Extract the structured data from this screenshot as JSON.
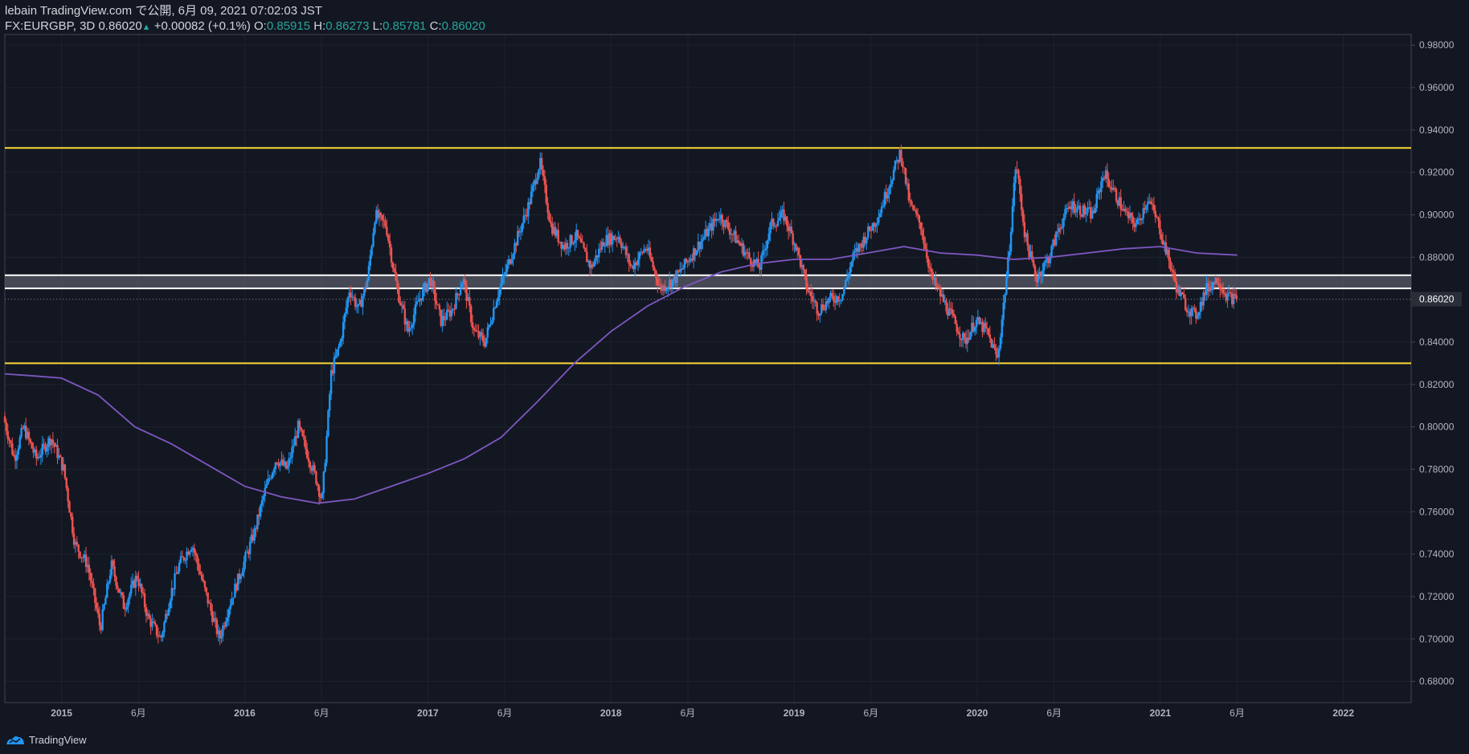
{
  "header": {
    "publish_line": "lebain TradingView.com で公開, 6月 09, 2021 07:02:03 JST",
    "symbol": "FX:EURGBP, 3D",
    "last": "0.86020",
    "change": "+0.00082 (+0.1%)",
    "o_label": "O:",
    "o_value": "0.85915",
    "h_label": "H:",
    "h_value": "0.86273",
    "l_label": "L:",
    "l_value": "0.85781",
    "c_label": "C:",
    "c_value": "0.86020"
  },
  "footer": {
    "brand": "TradingView",
    "logo_icon": "tradingview-logo-icon"
  },
  "colors": {
    "background": "#131722",
    "up": "#2196f3",
    "down": "#ef5350",
    "ma": "#7e57c2",
    "support_resistance": "#fdd835",
    "zone": "#ffffff",
    "grid": "#1e222d",
    "axis_text": "#b2b5be"
  },
  "chart_data": {
    "type": "candlestick",
    "symbol": "FX:EURGBP",
    "interval": "3D",
    "ylim": [
      0.67,
      0.985
    ],
    "y_ticks": [
      "0.98000",
      "0.96000",
      "0.94000",
      "0.92000",
      "0.90000",
      "0.88000",
      "0.86000",
      "0.84000",
      "0.82000",
      "0.80000",
      "0.78000",
      "0.76000",
      "0.74000",
      "0.72000",
      "0.70000",
      "0.68000"
    ],
    "x_ticks": [
      {
        "t": 2015.0,
        "label": "2015"
      },
      {
        "t": 2015.42,
        "label": "6月"
      },
      {
        "t": 2016.0,
        "label": "2016"
      },
      {
        "t": 2016.42,
        "label": "6月"
      },
      {
        "t": 2017.0,
        "label": "2017"
      },
      {
        "t": 2017.42,
        "label": "6月"
      },
      {
        "t": 2018.0,
        "label": "2018"
      },
      {
        "t": 2018.42,
        "label": "6月"
      },
      {
        "t": 2019.0,
        "label": "2019"
      },
      {
        "t": 2019.42,
        "label": "6月"
      },
      {
        "t": 2020.0,
        "label": "2020"
      },
      {
        "t": 2020.42,
        "label": "6月"
      },
      {
        "t": 2021.0,
        "label": "2021"
      },
      {
        "t": 2021.42,
        "label": "6月"
      },
      {
        "t": 2022.0,
        "label": "2022"
      }
    ],
    "xlim": [
      2014.69,
      2022.37
    ],
    "last_price": 0.8602,
    "last_price_label": "0.86020",
    "horizontal_lines": [
      {
        "name": "resistance",
        "price": 0.9315,
        "color": "#fdd835"
      },
      {
        "name": "support",
        "price": 0.83,
        "color": "#fdd835"
      }
    ],
    "zone": {
      "top": 0.8715,
      "bottom": 0.8653,
      "color": "#ffffff"
    },
    "price_path": [
      [
        2014.69,
        0.805
      ],
      [
        2014.75,
        0.785
      ],
      [
        2014.8,
        0.8
      ],
      [
        2014.87,
        0.785
      ],
      [
        2014.95,
        0.795
      ],
      [
        2015.02,
        0.78
      ],
      [
        2015.08,
        0.745
      ],
      [
        2015.15,
        0.735
      ],
      [
        2015.22,
        0.705
      ],
      [
        2015.28,
        0.735
      ],
      [
        2015.35,
        0.715
      ],
      [
        2015.42,
        0.73
      ],
      [
        2015.48,
        0.71
      ],
      [
        2015.55,
        0.7
      ],
      [
        2015.6,
        0.72
      ],
      [
        2015.65,
        0.735
      ],
      [
        2015.72,
        0.745
      ],
      [
        2015.8,
        0.72
      ],
      [
        2015.87,
        0.7
      ],
      [
        2015.92,
        0.715
      ],
      [
        2016.0,
        0.735
      ],
      [
        2016.06,
        0.75
      ],
      [
        2016.12,
        0.77
      ],
      [
        2016.18,
        0.785
      ],
      [
        2016.24,
        0.78
      ],
      [
        2016.3,
        0.8
      ],
      [
        2016.36,
        0.785
      ],
      [
        2016.4,
        0.775
      ],
      [
        2016.43,
        0.765
      ],
      [
        2016.46,
        0.8
      ],
      [
        2016.48,
        0.825
      ],
      [
        2016.53,
        0.84
      ],
      [
        2016.58,
        0.865
      ],
      [
        2016.63,
        0.855
      ],
      [
        2016.68,
        0.87
      ],
      [
        2016.72,
        0.9
      ],
      [
        2016.78,
        0.895
      ],
      [
        2016.84,
        0.865
      ],
      [
        2016.9,
        0.845
      ],
      [
        2016.96,
        0.86
      ],
      [
        2017.02,
        0.87
      ],
      [
        2017.08,
        0.85
      ],
      [
        2017.14,
        0.855
      ],
      [
        2017.2,
        0.87
      ],
      [
        2017.26,
        0.845
      ],
      [
        2017.32,
        0.84
      ],
      [
        2017.38,
        0.86
      ],
      [
        2017.44,
        0.875
      ],
      [
        2017.5,
        0.89
      ],
      [
        2017.56,
        0.905
      ],
      [
        2017.62,
        0.925
      ],
      [
        2017.68,
        0.895
      ],
      [
        2017.75,
        0.885
      ],
      [
        2017.82,
        0.89
      ],
      [
        2017.9,
        0.875
      ],
      [
        2017.97,
        0.888
      ],
      [
        2018.05,
        0.89
      ],
      [
        2018.12,
        0.875
      ],
      [
        2018.2,
        0.885
      ],
      [
        2018.28,
        0.865
      ],
      [
        2018.36,
        0.87
      ],
      [
        2018.44,
        0.88
      ],
      [
        2018.52,
        0.89
      ],
      [
        2018.6,
        0.9
      ],
      [
        2018.68,
        0.89
      ],
      [
        2018.76,
        0.88
      ],
      [
        2018.82,
        0.875
      ],
      [
        2018.88,
        0.895
      ],
      [
        2018.95,
        0.9
      ],
      [
        2019.02,
        0.885
      ],
      [
        2019.08,
        0.865
      ],
      [
        2019.14,
        0.855
      ],
      [
        2019.2,
        0.86
      ],
      [
        2019.27,
        0.862
      ],
      [
        2019.33,
        0.88
      ],
      [
        2019.4,
        0.89
      ],
      [
        2019.47,
        0.9
      ],
      [
        2019.53,
        0.915
      ],
      [
        2019.59,
        0.93
      ],
      [
        2019.64,
        0.905
      ],
      [
        2019.7,
        0.895
      ],
      [
        2019.76,
        0.87
      ],
      [
        2019.82,
        0.86
      ],
      [
        2019.88,
        0.85
      ],
      [
        2019.94,
        0.84
      ],
      [
        2020.0,
        0.85
      ],
      [
        2020.06,
        0.845
      ],
      [
        2020.12,
        0.832
      ],
      [
        2020.18,
        0.88
      ],
      [
        2020.22,
        0.925
      ],
      [
        2020.27,
        0.89
      ],
      [
        2020.33,
        0.87
      ],
      [
        2020.4,
        0.88
      ],
      [
        2020.46,
        0.895
      ],
      [
        2020.52,
        0.905
      ],
      [
        2020.58,
        0.902
      ],
      [
        2020.64,
        0.9
      ],
      [
        2020.7,
        0.92
      ],
      [
        2020.76,
        0.91
      ],
      [
        2020.82,
        0.9
      ],
      [
        2020.88,
        0.895
      ],
      [
        2020.94,
        0.908
      ],
      [
        2021.0,
        0.895
      ],
      [
        2021.05,
        0.88
      ],
      [
        2021.1,
        0.865
      ],
      [
        2021.15,
        0.857
      ],
      [
        2021.2,
        0.852
      ],
      [
        2021.26,
        0.865
      ],
      [
        2021.32,
        0.87
      ],
      [
        2021.37,
        0.862
      ],
      [
        2021.42,
        0.86
      ]
    ],
    "ma_path": [
      [
        2014.69,
        0.825
      ],
      [
        2014.85,
        0.824
      ],
      [
        2015.0,
        0.823
      ],
      [
        2015.2,
        0.815
      ],
      [
        2015.4,
        0.8
      ],
      [
        2015.6,
        0.792
      ],
      [
        2015.8,
        0.782
      ],
      [
        2016.0,
        0.772
      ],
      [
        2016.2,
        0.767
      ],
      [
        2016.4,
        0.764
      ],
      [
        2016.6,
        0.766
      ],
      [
        2016.8,
        0.772
      ],
      [
        2017.0,
        0.778
      ],
      [
        2017.2,
        0.785
      ],
      [
        2017.4,
        0.795
      ],
      [
        2017.6,
        0.812
      ],
      [
        2017.8,
        0.83
      ],
      [
        2018.0,
        0.845
      ],
      [
        2018.2,
        0.857
      ],
      [
        2018.4,
        0.866
      ],
      [
        2018.6,
        0.873
      ],
      [
        2018.8,
        0.877
      ],
      [
        2019.0,
        0.879
      ],
      [
        2019.2,
        0.879
      ],
      [
        2019.4,
        0.882
      ],
      [
        2019.6,
        0.885
      ],
      [
        2019.8,
        0.882
      ],
      [
        2020.0,
        0.881
      ],
      [
        2020.2,
        0.879
      ],
      [
        2020.4,
        0.88
      ],
      [
        2020.6,
        0.882
      ],
      [
        2020.8,
        0.884
      ],
      [
        2021.0,
        0.885
      ],
      [
        2021.2,
        0.882
      ],
      [
        2021.42,
        0.881
      ]
    ]
  }
}
